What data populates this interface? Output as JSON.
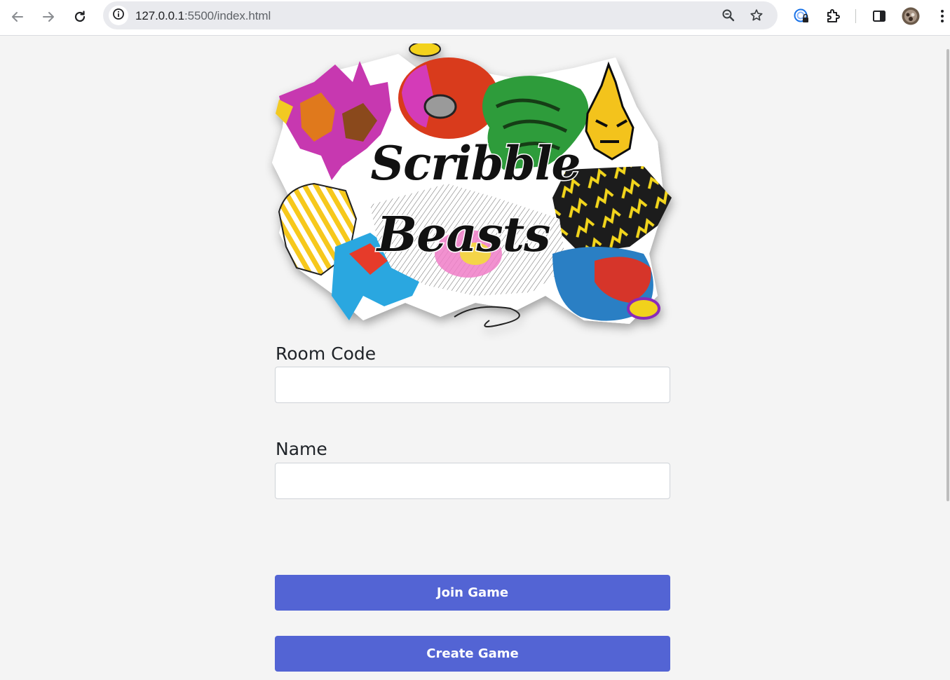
{
  "browser": {
    "url_host": "127.0.0.1",
    "url_path": ":5500/index.html",
    "icons": [
      "back-arrow-icon",
      "forward-arrow-icon",
      "reload-icon",
      "site-info-icon",
      "zoom-icon",
      "bookmark-star-icon",
      "password-manager-icon",
      "extensions-icon",
      "side-panel-icon",
      "profile-avatar-icon",
      "more-menu-icon"
    ]
  },
  "logo": {
    "line1": "Scribble",
    "line2": "Beasts"
  },
  "form": {
    "room_code_label": "Room Code",
    "room_code_value": "",
    "name_label": "Name",
    "name_value": "",
    "join_label": "Join Game",
    "create_label": "Create Game"
  },
  "colors": {
    "page_background": "#f4f4f4",
    "button": "#5364d4",
    "button_text": "#ffffff"
  }
}
